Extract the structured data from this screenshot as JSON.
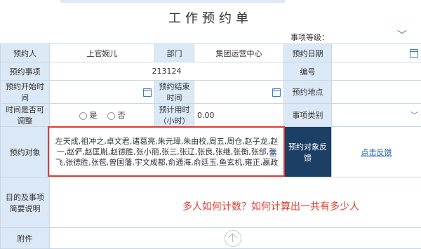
{
  "title": "工作预约单",
  "level": {
    "label": "事项等级："
  },
  "rows": {
    "appointee_label": "预约人",
    "appointee_value": "上官婉儿",
    "dept_label": "部门",
    "dept_value": "集团运营中心",
    "date_label": "预约日期",
    "item_label": "预约事项",
    "item_value": "213124",
    "number_label": "编号",
    "start_label": "预约开始时间",
    "end_label": "预约结束时间",
    "place_label": "预约地点",
    "timecheck_label": "时间是否可调整",
    "radio_yes": "是",
    "radio_no": "否",
    "duration_label": "预计用时（小时）",
    "duration_value": "0.00",
    "category_label": "事项类别",
    "target_label": "预约对象",
    "target_names": "左天成,祖冲之,卓文君,诸葛亮,朱元璋,朱由校,周五,周仓,赵子龙,赵一,赵俨,赵匡胤,赵德胜,张小丽,张三,张辽,张良,张继,张衡,张郃,张飞,张德胜,张苞,曾国藩,宇文成都,俞通海,俞廷玉,鱼玄机,雍正,嬴政",
    "feedback_label": "预约对象反馈",
    "feedback_link": "点击反馈",
    "purpose_label": "目的及事项简要说明",
    "attach_label": "附件"
  },
  "annotation": "多人如何计数？如何计算出一共有多少人",
  "colors": {
    "accent": "#3a78c4",
    "label_bg": "#dbe8f6",
    "dark": "#1c3f66",
    "red": "#e23b2e"
  }
}
